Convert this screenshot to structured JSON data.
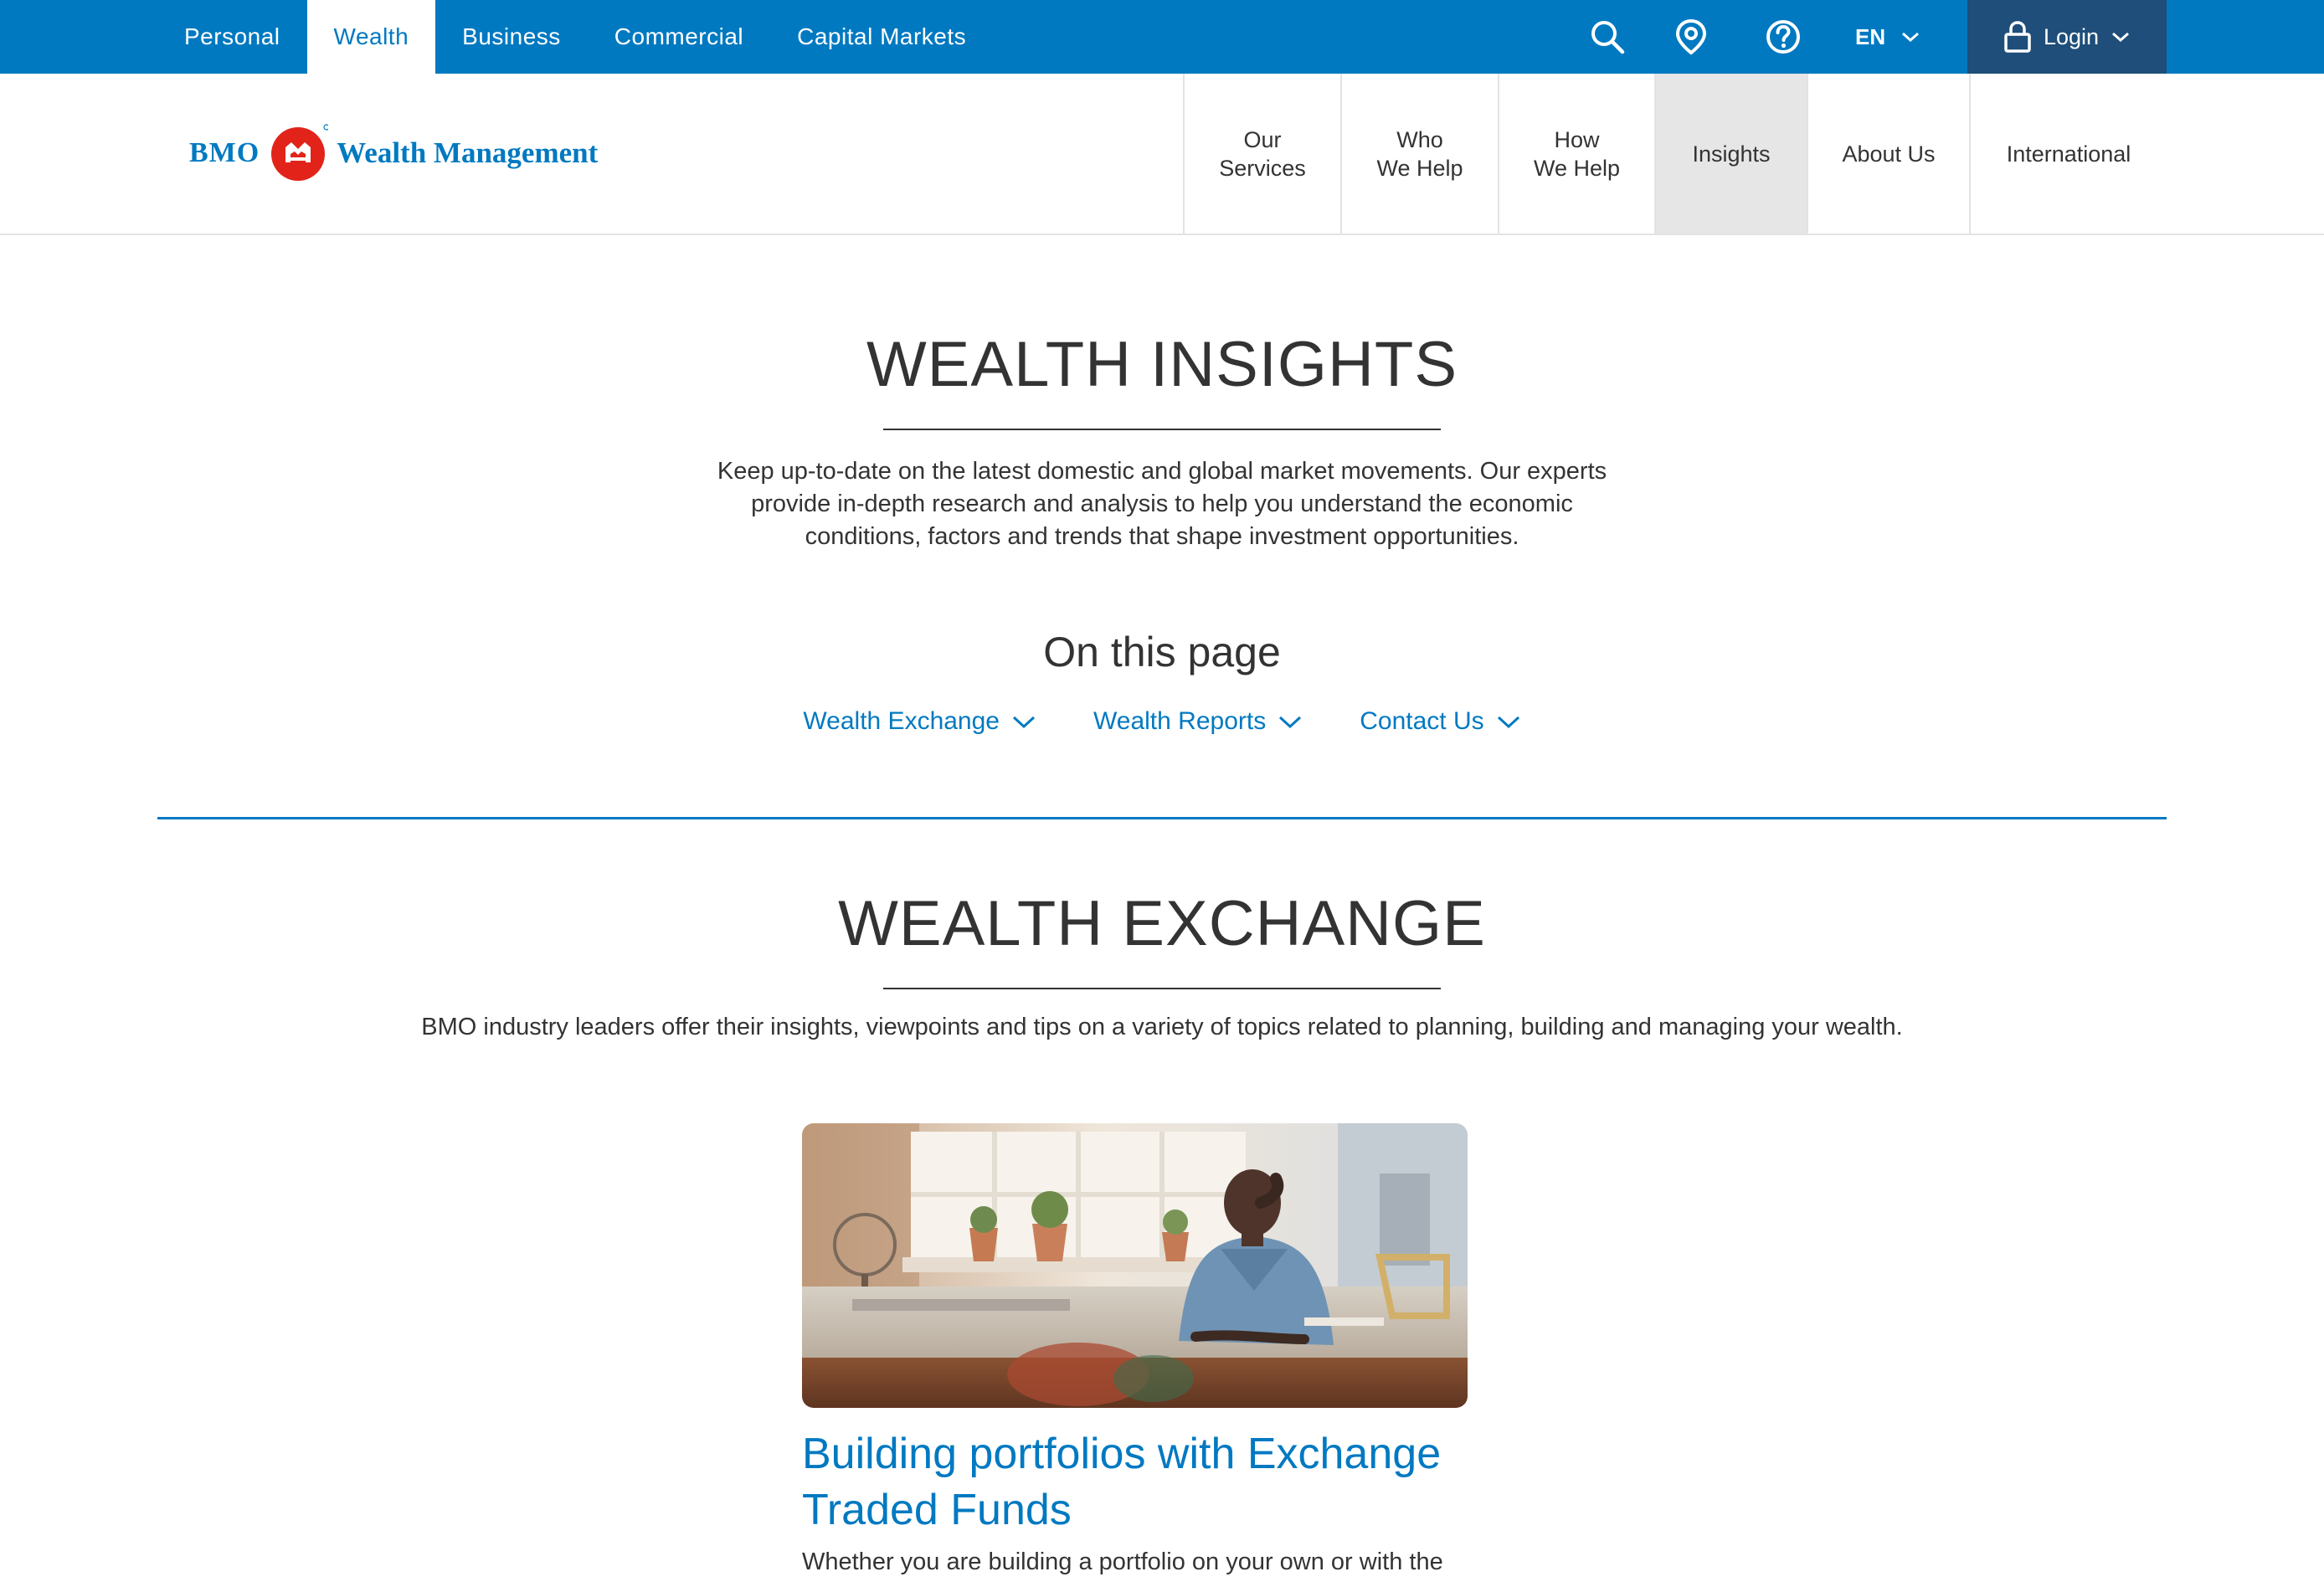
{
  "top_nav": {
    "tabs": [
      {
        "label": "Personal",
        "active": false
      },
      {
        "label": "Wealth",
        "active": true
      },
      {
        "label": "Business",
        "active": false
      },
      {
        "label": "Commercial",
        "active": false
      },
      {
        "label": "Capital Markets",
        "active": false
      }
    ],
    "icons": [
      "search-icon",
      "location-pin-icon",
      "help-icon"
    ],
    "language": "EN",
    "login_label": "Login"
  },
  "brand": {
    "bank": "BMO",
    "division": "Wealth Management",
    "color_primary": "#0079c1",
    "color_roundel": "#e2231a"
  },
  "main_nav": {
    "items": [
      {
        "label": "Our\nServices",
        "active": false
      },
      {
        "label": "Who\nWe Help",
        "active": false
      },
      {
        "label": "How\nWe Help",
        "active": false
      },
      {
        "label": "Insights",
        "active": true
      },
      {
        "label": "About Us",
        "active": false
      },
      {
        "label": "International",
        "active": false
      }
    ]
  },
  "insights": {
    "title": "WEALTH INSIGHTS",
    "intro_lines": [
      "Keep up-to-date on the latest domestic and global market movements. Our experts",
      "provide in-depth research and analysis to help you understand the economic",
      "conditions, factors and trends that shape investment opportunities."
    ],
    "on_this_page": "On this page",
    "jump_links": [
      "Wealth Exchange",
      "Wealth Reports",
      "Contact Us"
    ]
  },
  "exchange": {
    "title": "WEALTH EXCHANGE",
    "description": "BMO industry leaders offer their insights, viewpoints and tips on a variety of topics related to planning, building and managing your wealth.",
    "card": {
      "title": "Building portfolios with Exchange Traded Funds",
      "teaser": "Whether you are building a portfolio on your own or with the"
    }
  }
}
